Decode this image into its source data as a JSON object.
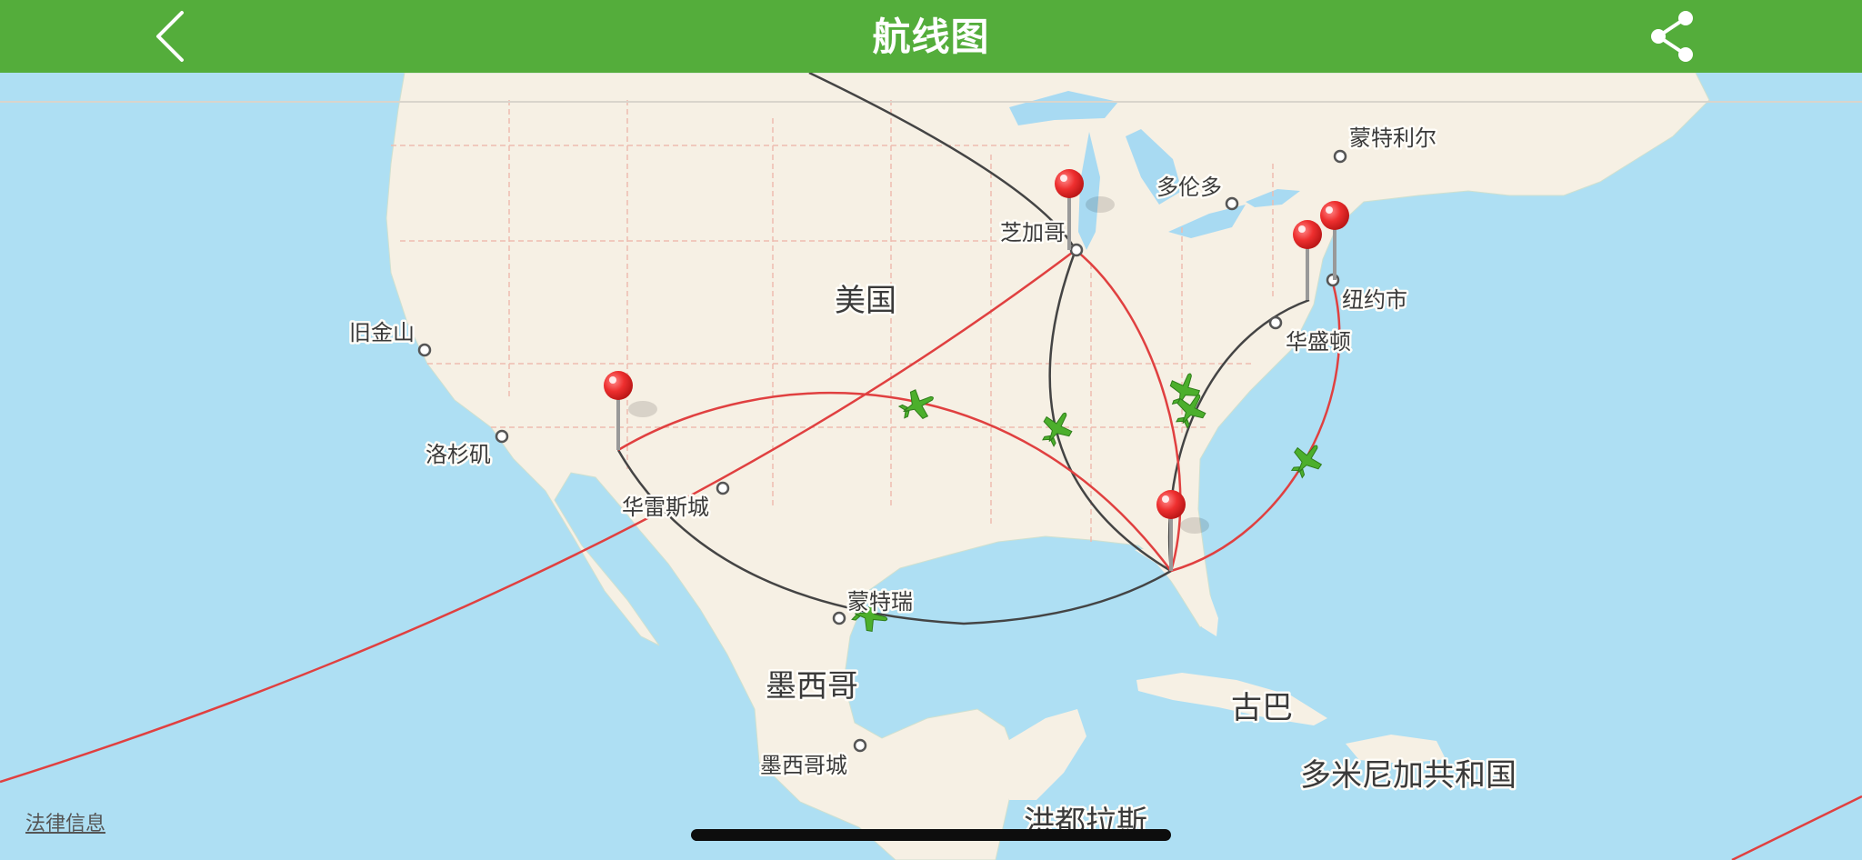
{
  "header": {
    "title": "航线图"
  },
  "map": {
    "countries": [
      "美国",
      "墨西哥",
      "古巴",
      "多米尼加共和国",
      "洪都拉斯"
    ],
    "cities": [
      "蒙特利尔",
      "多伦多",
      "芝加哥",
      "纽约市",
      "华盛顿",
      "旧金山",
      "洛杉矶",
      "华雷斯城",
      "蒙特瑞",
      "墨西哥城"
    ],
    "route_colors": {
      "outbound": "#e04040",
      "return": "#444444"
    },
    "pin_color": "#ee2f2f",
    "plane_color": "#4caf2c"
  },
  "footer": {
    "legal": "法律信息"
  }
}
